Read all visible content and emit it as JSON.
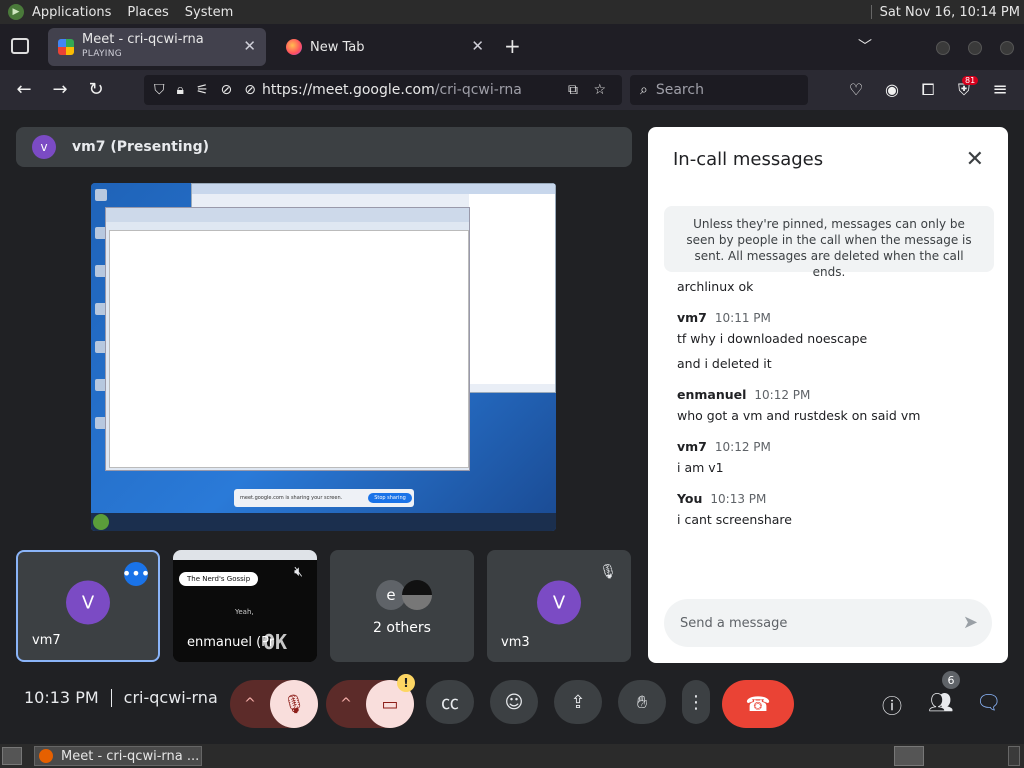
{
  "os": {
    "menu": [
      "Applications",
      "Places",
      "System"
    ],
    "clock": "Sat Nov 16, 10:14 PM"
  },
  "browser": {
    "tabs": [
      {
        "title": "Meet - cri-qcwi-rna",
        "subtitle": "PLAYING",
        "active": true
      },
      {
        "title": "New Tab",
        "active": false
      }
    ],
    "url_host": "https://meet.google.com",
    "url_path": "/cri-qcwi-rna",
    "search_placeholder": "Search",
    "extension_badge": "81"
  },
  "meet": {
    "presenter_initial": "v",
    "presenting_label": "vm7 (Presenting)",
    "tiles": [
      {
        "name": "vm7",
        "initial": "V"
      },
      {
        "name": "enmanuel (Pr",
        "chip": "The Nerd's Gossip",
        "overlay_text": "Yeah,",
        "logo": "OK"
      },
      {
        "name": "2 others",
        "initial": "e"
      },
      {
        "name": "vm3",
        "initial": "V"
      }
    ],
    "time": "10:13 PM",
    "meeting_code": "cri-qcwi-rna",
    "participant_count": "6",
    "camera_warning": "!"
  },
  "chat": {
    "title": "In-call messages",
    "notice": "Unless they're pinned, messages can only be seen by people in the call when the message is sent. All messages are deleted when the call ends.",
    "partial_line": "archlinux ok",
    "messages": [
      {
        "sender": "vm7",
        "time": "10:11 PM",
        "lines": [
          "tf why i downloaded noescape",
          "and i deleted it"
        ]
      },
      {
        "sender": "enmanuel",
        "time": "10:12 PM",
        "lines": [
          "who got a vm and rustdesk on said vm"
        ]
      },
      {
        "sender": "vm7",
        "time": "10:12 PM",
        "lines": [
          "i am v1"
        ]
      },
      {
        "sender": "You",
        "time": "10:13 PM",
        "lines": [
          "i cant screenshare"
        ]
      }
    ],
    "composer_placeholder": "Send a message"
  },
  "shared_screen": {
    "notification_text": "meet.google.com is sharing your screen.",
    "stop_button": "Stop sharing"
  },
  "taskbar": {
    "task_label": "Meet - cri-qcwi-rna ..."
  },
  "colors": {
    "meet_bg": "#202124",
    "accent_blue": "#1a73e8",
    "end_call_red": "#ea4335",
    "avatar_purple": "#7b4bc4"
  }
}
